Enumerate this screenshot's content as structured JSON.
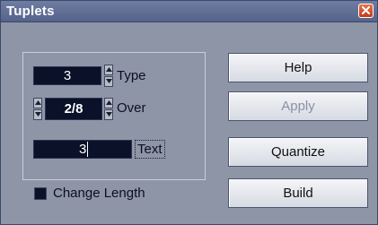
{
  "window": {
    "title": "Tuplets"
  },
  "panel": {
    "type": {
      "value": "3",
      "label": "Type"
    },
    "over": {
      "value": "2/8",
      "label": "Over"
    },
    "text": {
      "value": "3",
      "label": "Text"
    },
    "change_length": {
      "label": "Change Length",
      "checked": false
    }
  },
  "buttons": {
    "help": "Help",
    "apply": "Apply",
    "quantize": "Quantize",
    "build": "Build"
  },
  "icons": {
    "close": "close-icon",
    "spin_up": "arrow-up-icon",
    "spin_down": "arrow-down-icon"
  },
  "colors": {
    "title_bar": "#5f6d95",
    "window_bg": "#8e95a6",
    "lcd_bg": "#0a1128",
    "close": "#d4522c"
  }
}
